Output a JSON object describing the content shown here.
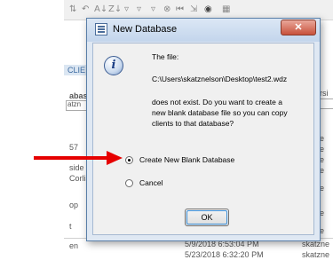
{
  "background": {
    "header_fragment": "CLIE",
    "left_texts": [
      "abas",
      "atzn",
      "57",
      "side",
      "Corlis",
      "op",
      "t",
      "en"
    ],
    "right_texts": [
      "rsi",
      "e",
      "e",
      "e",
      "e",
      "e",
      "e",
      "e"
    ],
    "bottom_rows": [
      {
        "date": "5/9/2018 6:53:04 PM",
        "user": "skatzne"
      },
      {
        "date": "5/23/2018 6:32:20 PM",
        "user": "skatzne"
      }
    ]
  },
  "dialog": {
    "title": "New Database",
    "close_label": "✕",
    "message_line1": "The file:",
    "file_path": "C:\\Users\\skatznelson\\Desktop\\test2.wdz",
    "message_line2": "does not exist.  Do you want to create a",
    "message_line3": "new blank database file so you can copy",
    "message_line4": "clients to that database?",
    "options": [
      {
        "label": "Create New Blank Database",
        "selected": true
      },
      {
        "label": "Cancel",
        "selected": false
      }
    ],
    "ok_label": "OK"
  },
  "colors": {
    "annotation_arrow": "#e60000",
    "dialog_frame": "#dfe8f3",
    "close_button": "#c8523c"
  },
  "icons": [
    "toolbar-icons",
    "database-icon",
    "info-icon",
    "close-icon",
    "arrow-annotation"
  ]
}
